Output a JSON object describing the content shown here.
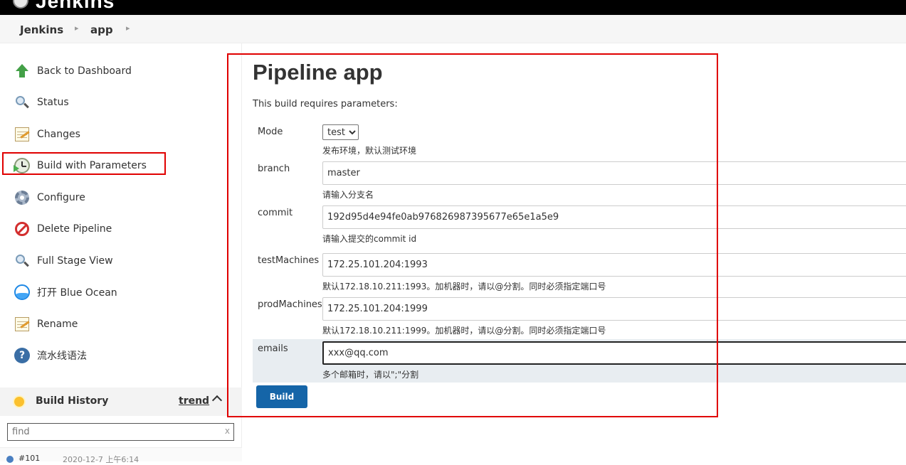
{
  "header": {
    "brand": "Jenkins"
  },
  "breadcrumbs": [
    {
      "label": "Jenkins"
    },
    {
      "label": "app"
    }
  ],
  "sidebar": {
    "tasks": [
      {
        "label": "Back to Dashboard",
        "icon": "up-arrow-icon"
      },
      {
        "label": "Status",
        "icon": "magnifier-icon"
      },
      {
        "label": "Changes",
        "icon": "notepad-icon"
      },
      {
        "label": "Build with Parameters",
        "icon": "clock-icon"
      },
      {
        "label": "Configure",
        "icon": "gear-icon"
      },
      {
        "label": "Delete Pipeline",
        "icon": "no-entry-icon"
      },
      {
        "label": "Full Stage View",
        "icon": "magnifier-icon"
      },
      {
        "label": "打开 Blue Ocean",
        "icon": "blue-ocean-icon"
      },
      {
        "label": "Rename",
        "icon": "notepad-icon"
      },
      {
        "label": "流水线语法",
        "icon": "help-icon"
      }
    ],
    "build_history": {
      "title": "Build History",
      "trend": "trend",
      "find_placeholder": "find",
      "clear": "x",
      "builds": [
        {
          "number": "#101",
          "date": "2020-12-7 上午6:14"
        }
      ]
    }
  },
  "main": {
    "title": "Pipeline app",
    "requires_text": "This build requires parameters:",
    "params": {
      "mode": {
        "label": "Mode",
        "value": "test",
        "options": [
          "test"
        ],
        "desc": "发布环境，默认测试环境"
      },
      "branch": {
        "label": "branch",
        "value": "master",
        "desc": "请输入分支名"
      },
      "commit": {
        "label": "commit",
        "value": "192d95d4e94fe0ab976826987395677e65e1a5e9",
        "desc": "请输入提交的commit id"
      },
      "testMachines": {
        "label": "testMachines",
        "value": "172.25.101.204:1993",
        "desc": "默认172.18.10.211:1993。加机器时，请以@分割。同时必须指定端口号"
      },
      "prodMachines": {
        "label": "prodMachines",
        "value": "172.25.101.204:1999",
        "desc": "默认172.18.10.211:1999。加机器时，请以@分割。同时必须指定端口号"
      },
      "emails": {
        "label": "emails",
        "value": "xxx@qq.com",
        "desc": "多个邮箱时，请以\";\"分割"
      }
    },
    "build_button": "Build"
  },
  "colors": {
    "highlight": "#e00000",
    "build_button": "#1565a8",
    "header_bg": "#000000"
  }
}
